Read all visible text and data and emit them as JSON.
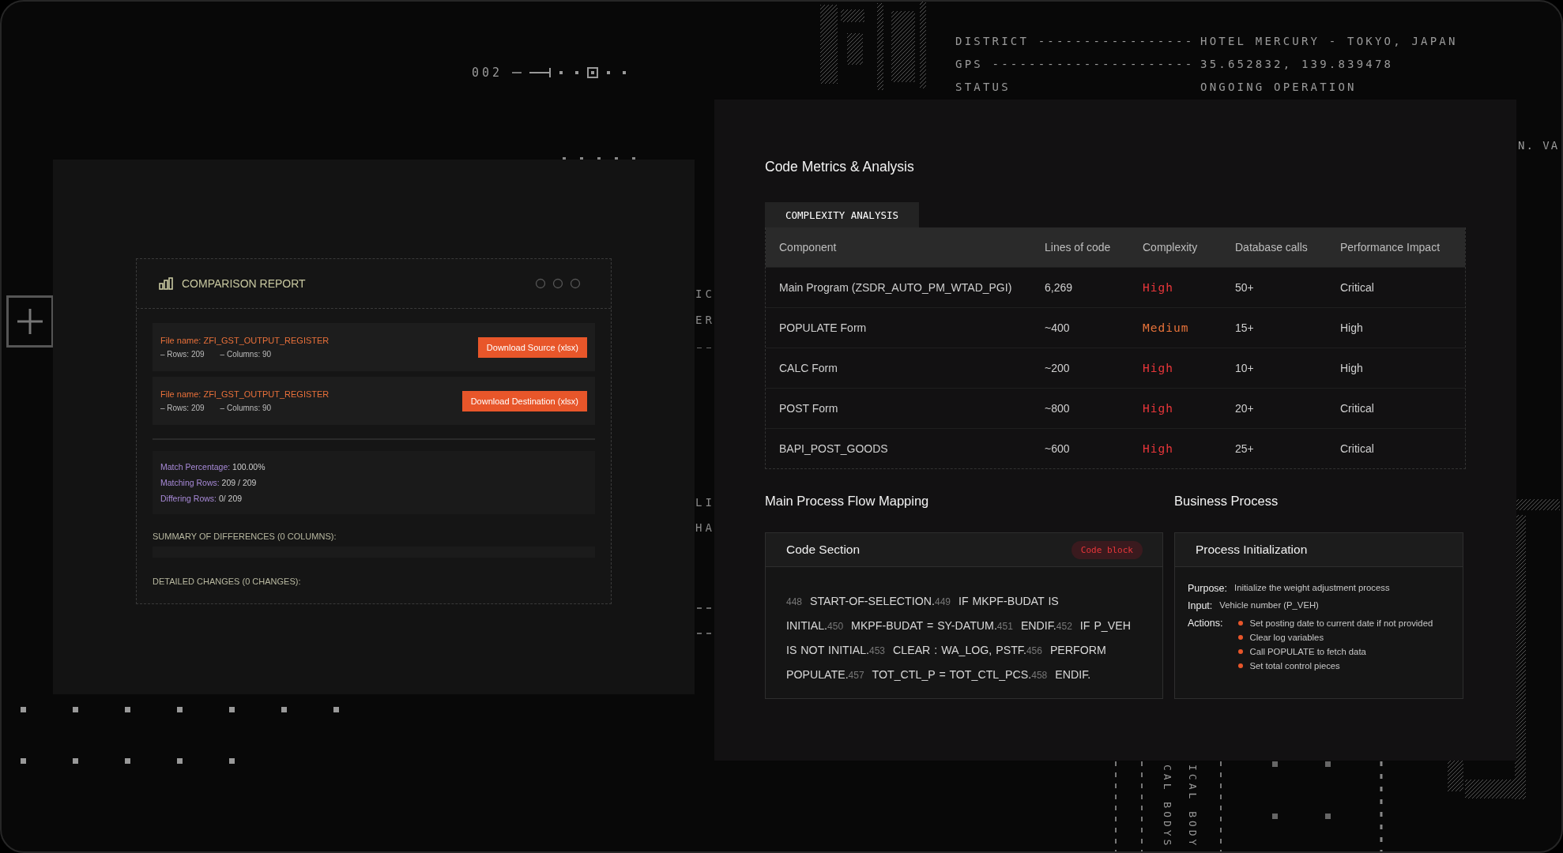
{
  "sequence_code": "002",
  "location_info": [
    {
      "label": "DISTRICT",
      "leader": "-----------------",
      "value": "HOTEL MERCURY - TOKYO, JAPAN"
    },
    {
      "label": "GPS",
      "leader": "----------------------",
      "value": "35.652832, 139.839478"
    },
    {
      "label": "STATUS",
      "value": "ONGOING OPERATION"
    }
  ],
  "edge_fragment": "N. VA",
  "side_fragments": [
    "IC",
    "ER",
    "LI",
    "HA"
  ],
  "vertical_labels": [
    "CAL BODYS",
    "ICAL BODY"
  ],
  "comparison_report": {
    "title": "COMPARISON REPORT",
    "files": [
      {
        "name": "File name: ZFI_GST_OUTPUT_REGISTER",
        "rows": "– Rows: 209",
        "columns": "– Columns: 90",
        "button": "Download Source (xlsx)"
      },
      {
        "name": "File name: ZFI_GST_OUTPUT_REGISTER",
        "rows": "– Rows: 209",
        "columns": "– Columns: 90",
        "button": "Download Destination (xlsx)"
      }
    ],
    "stats": [
      {
        "label": "Match Percentage:",
        "value": "100.00%"
      },
      {
        "label": "Matching Rows:",
        "value": "209 / 209"
      },
      {
        "label": "Differing Rows:",
        "value": "0/ 209"
      }
    ],
    "summary": "SUMMARY OF DIFFERENCES (0 COLUMNS):",
    "details": "DETAILED CHANGES (0 CHANGES):"
  },
  "metrics": {
    "title": "Code Metrics & Analysis",
    "tabs": [
      {
        "label": "COMPLEXITY ANALYSIS",
        "selected": true
      }
    ],
    "columns": [
      "Component",
      "Lines of code",
      "Complexity",
      "Database calls",
      "Performance Impact"
    ],
    "rows": [
      {
        "component": "Main Program (ZSDR_AUTO_PM_WTAD_PGI)",
        "lines": "6,269",
        "complexity": "High",
        "kind": "high",
        "db_calls": "50+",
        "impact": "Critical"
      },
      {
        "component": "POPULATE Form",
        "lines": "~400",
        "complexity": "Medium",
        "kind": "medium",
        "db_calls": "15+",
        "impact": "High"
      },
      {
        "component": "CALC Form",
        "lines": "~200",
        "complexity": "High",
        "kind": "high",
        "db_calls": "10+",
        "impact": "High"
      },
      {
        "component": "POST Form",
        "lines": "~800",
        "complexity": "High",
        "kind": "high",
        "db_calls": "20+",
        "impact": "Critical"
      },
      {
        "component": "BAPI_POST_GOODS",
        "lines": "~600",
        "complexity": "High",
        "kind": "high",
        "db_calls": "25+",
        "impact": "Critical"
      }
    ]
  },
  "flow": {
    "title": "Main Process Flow Mapping",
    "card_title": "Code Section",
    "badge": "Code block",
    "lines": [
      {
        "number": "448",
        "code": "START-OF-SELECTION."
      },
      {
        "number": "449",
        "code": "IF MKPF-BUDAT IS INITIAL."
      },
      {
        "number": "450",
        "code": "MKPF-BUDAT = SY-DATUM."
      },
      {
        "number": "451",
        "code": "ENDIF."
      },
      {
        "number": "452",
        "code": "IF P_VEH IS NOT INITIAL."
      },
      {
        "number": "453",
        "code": "CLEAR :   WA_LOG, PSTF."
      },
      {
        "number": "456",
        "code": "PERFORM POPULATE."
      },
      {
        "number": "457",
        "code": "TOT_CTL_P = TOT_CTL_PCS."
      },
      {
        "number": "458",
        "code": "ENDIF."
      }
    ]
  },
  "business": {
    "title": "Business Process",
    "card_title": "Process Initialization",
    "purpose": {
      "label": "Purpose:",
      "value": "Initialize the weight adjustment process"
    },
    "input": {
      "label": "Input:",
      "value": "Vehicle number (P_VEH)"
    },
    "actions_label": "Actions:",
    "actions": [
      "Set posting date to current date if not provided",
      "Clear log variables",
      "Call POPULATE to fetch data",
      "Set total control pieces"
    ]
  }
}
